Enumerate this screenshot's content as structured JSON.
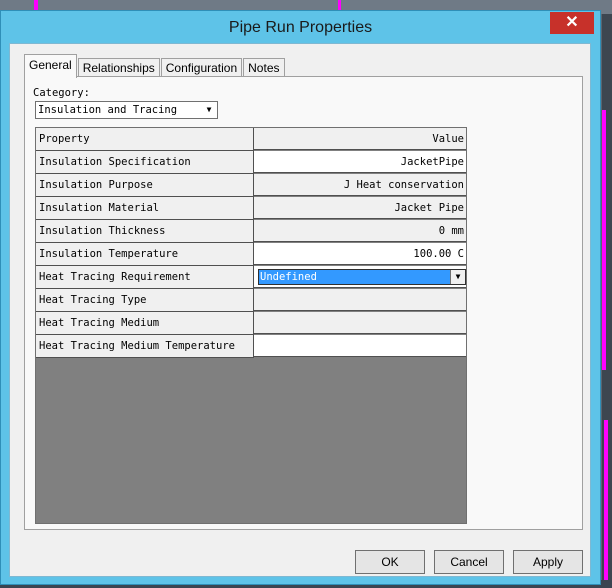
{
  "window": {
    "title": "Pipe Run Properties",
    "close_glyph": "✕"
  },
  "tabs": [
    {
      "label": "General"
    },
    {
      "label": "Relationships"
    },
    {
      "label": "Configuration"
    },
    {
      "label": "Notes"
    }
  ],
  "category": {
    "label": "Category:",
    "selected": "Insulation and Tracing"
  },
  "grid": {
    "header": {
      "property": "Property",
      "value": "Value"
    },
    "rows": [
      {
        "property": "Insulation Specification",
        "value": "JacketPipe"
      },
      {
        "property": "Insulation Purpose",
        "value": "J Heat conservation"
      },
      {
        "property": "Insulation Material",
        "value": "Jacket Pipe"
      },
      {
        "property": "Insulation Thickness",
        "value": "0 mm"
      },
      {
        "property": "Insulation Temperature",
        "value": "100.00 C"
      },
      {
        "property": "Heat Tracing Requirement",
        "value": "Undefined"
      },
      {
        "property": "Heat Tracing Type",
        "value": ""
      },
      {
        "property": "Heat Tracing Medium",
        "value": ""
      },
      {
        "property": "Heat Tracing Medium Temperature",
        "value": ""
      }
    ]
  },
  "buttons": {
    "ok": "OK",
    "cancel": "Cancel",
    "apply": "Apply"
  },
  "colors": {
    "title_bar": "#5ec3e8",
    "close": "#c7312a",
    "selection": "#3399ff"
  }
}
